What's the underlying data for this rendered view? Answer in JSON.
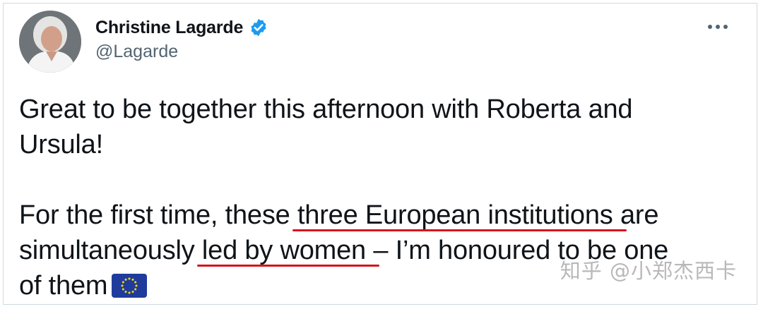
{
  "tweet": {
    "author": {
      "display_name": "Christine Lagarde",
      "handle": "@Lagarde",
      "verified": true
    },
    "more_icon": "more-horizontal-icon",
    "text_lines": {
      "p1_l1": "Great to be together this afternoon with Roberta and",
      "p1_l2": "Ursula!",
      "p2_l1_a": "For the first time, these ",
      "p2_l1_b": "three European institutions ",
      "p2_l1_c": "are",
      "p2_l2_a": "simultaneously ",
      "p2_l2_b": "led by women ",
      "p2_l2_c": "– I’m honoured to be one",
      "p2_l3": "of them"
    },
    "emoji": "eu-flag-icon"
  },
  "watermark": "知乎 @小郑杰西卡",
  "colors": {
    "underline": "#d4151e",
    "verified_badge": "#1d9bf0",
    "eu_blue": "#1f3c9c",
    "eu_star": "#ffdd00"
  }
}
